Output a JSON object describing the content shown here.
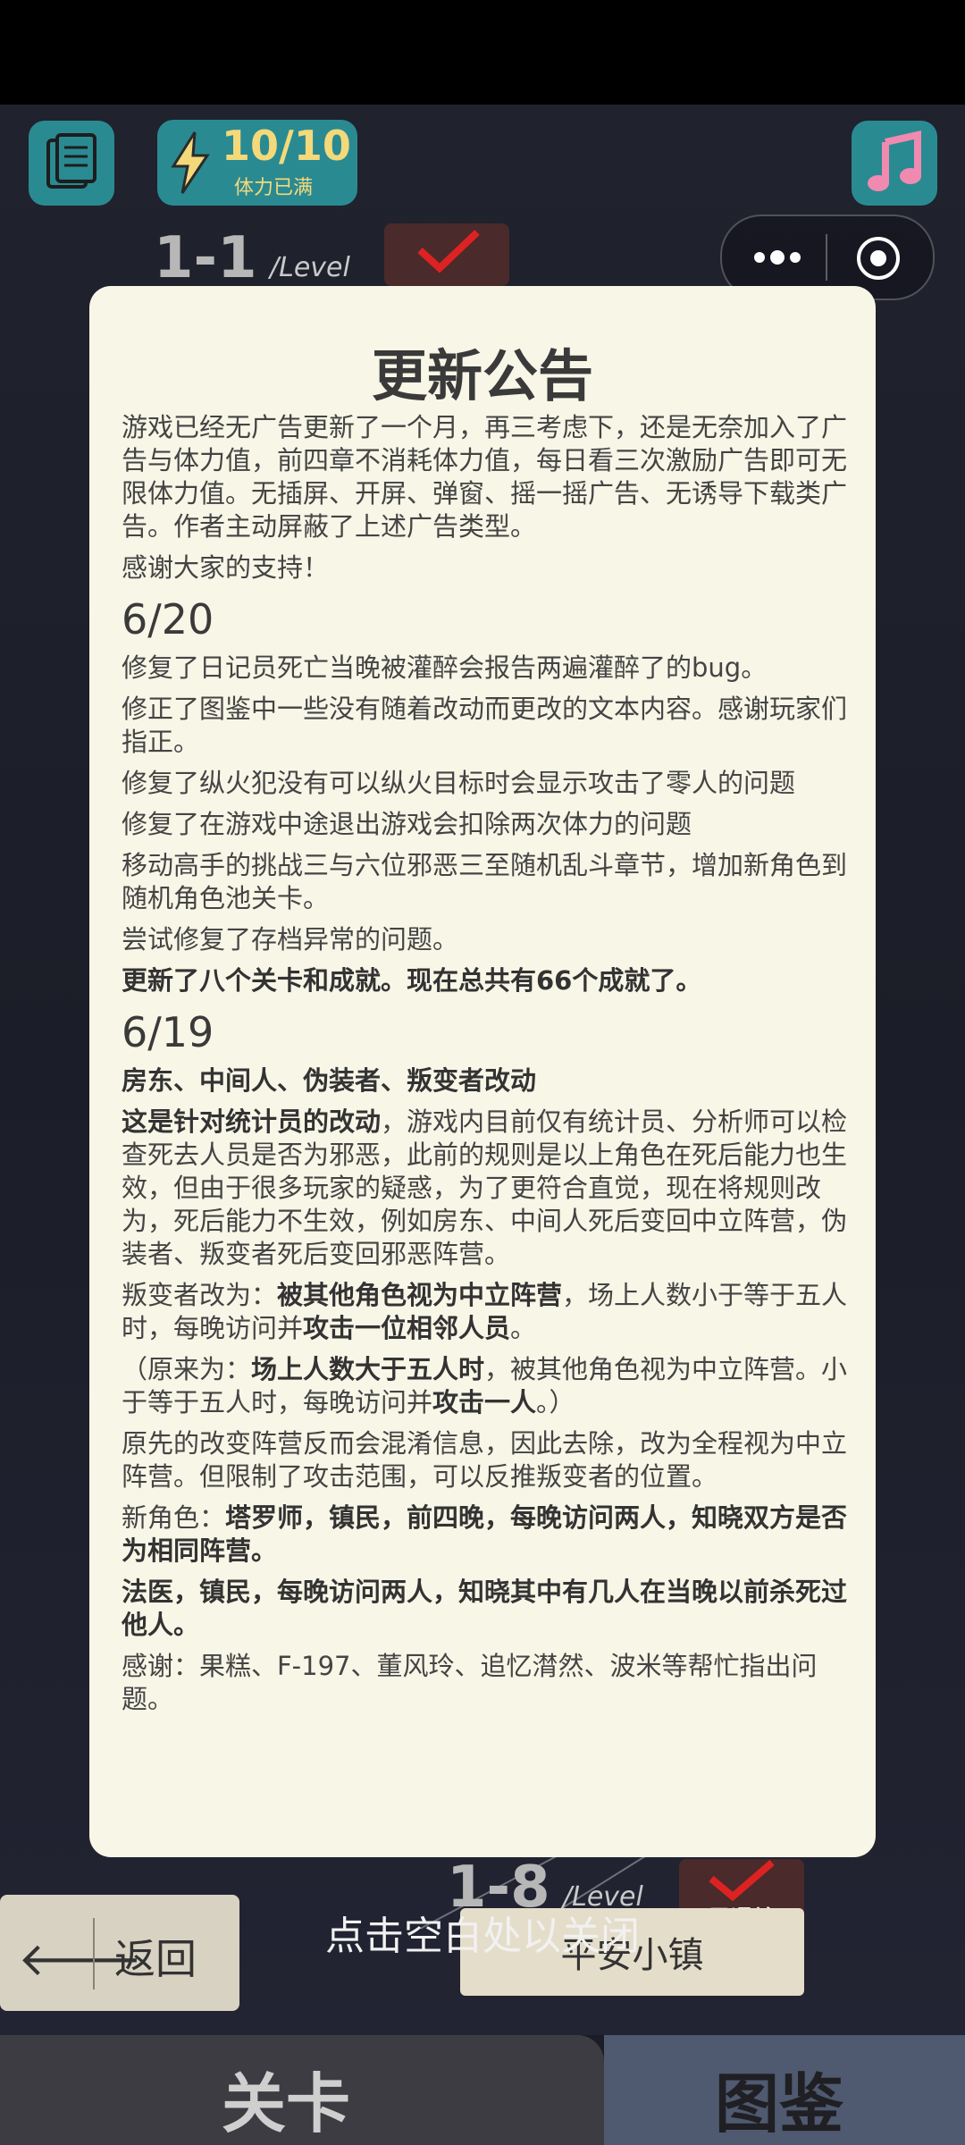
{
  "header": {
    "energy": {
      "count": "10/10",
      "status": "体力已满"
    }
  },
  "levels": {
    "top": {
      "number": "1-1",
      "suffix": "/Level",
      "badge": "已通关"
    },
    "bottom": {
      "number": "1-8",
      "suffix": "/Level",
      "badge": "已通关",
      "name": "平安小镇"
    }
  },
  "modal": {
    "title": "更新公告",
    "intro": "游戏已经无广告更新了一个月，再三考虑下，还是无奈加入了广告与体力值，前四章不消耗体力值，每日看三次激励广告即可无限体力值。无插屏、开屏、弹窗、摇一摇广告、无诱导下载类广告。作者主动屏蔽了上述广告类型。",
    "thanks": "感谢大家的支持！",
    "sections": [
      {
        "date": "6/20",
        "items": [
          "修复了日记员死亡当晚被灌醉会报告两遍灌醉了的bug。",
          "修正了图鉴中一些没有随着改动而更改的文本内容。感谢玩家们指正。",
          "修复了纵火犯没有可以纵火目标时会显示攻击了零人的问题",
          "修复了在游戏中途退出游戏会扣除两次体力的问题",
          "移动高手的挑战三与六位邪恶三至随机乱斗章节，增加新角色到随机角色池关卡。",
          "尝试修复了存档异常的问题。",
          "更新了八个关卡和成就。现在总共有66个成就了。"
        ]
      },
      {
        "date": "6/19",
        "heading": "房东、中间人、伪装者、叛变者改动",
        "p1_bold": "这是针对统计员的改动",
        "p1_rest": "，游戏内目前仅有统计员、分析师可以检查死去人员是否为邪恶，此前的规则是以上角色在死后能力也生效，但由于很多玩家的疑惑，为了更符合直觉，现在将规则改为，死后能力不生效，例如房东、中间人死后变回中立阵营，伪装者、叛变者死后变回邪恶阵营。",
        "p2_a": "叛变者改为：",
        "p2_b": "被其他角色视为中立阵营",
        "p2_c": "，场上人数小于等于五人时，每晚访问并",
        "p2_d": "攻击一位相邻人员",
        "p2_e": "。",
        "p3_a": "（原来为：",
        "p3_b": "场上人数大于五人时",
        "p3_c": "，被其他角色视为中立阵营。小于等于五人时，每晚访问并",
        "p3_d": "攻击一人",
        "p3_e": "。）",
        "p4": "原先的改变阵营反而会混淆信息，因此去除，改为全程视为中立阵营。但限制了攻击范围，可以反推叛变者的位置。",
        "p5_a": "新角色：",
        "p5_b": "塔罗师，镇民，前四晚，每晚访问两人，知晓双方是否为相同阵营。",
        "p6": "法医，镇民，每晚访问两人，知晓其中有几人在当晚以前杀死过他人。",
        "p7": "感谢：果糕、F-197、董风玲、追忆潸然、波米等帮忙指出问题。"
      }
    ]
  },
  "close_hint": "点击空白处以关闭",
  "back_button": {
    "arrow": "🡐",
    "label": "返回"
  },
  "tabs": [
    {
      "label": "关卡",
      "active": true
    },
    {
      "label": "图鉴",
      "active": false
    }
  ],
  "colors": {
    "teal_button": "#2a8a92",
    "modal_bg": "#f8f6e7",
    "music_note": "#f08ab0",
    "energy_yellow": "#f4d97a"
  }
}
